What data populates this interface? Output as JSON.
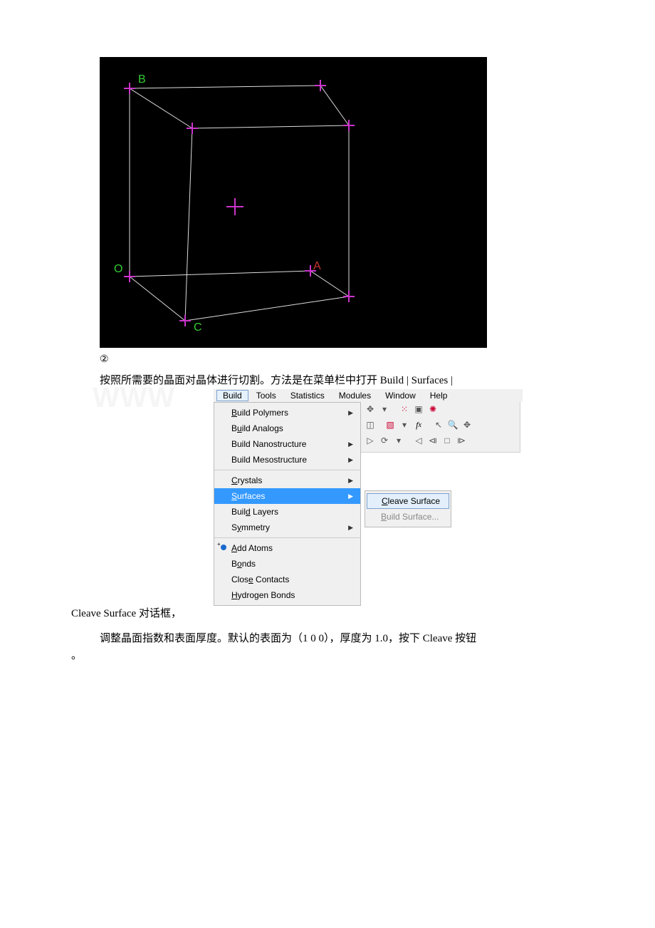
{
  "cube": {
    "labels": {
      "B": "B",
      "O": "O",
      "A": "A",
      "C": "C"
    }
  },
  "text": {
    "circled": "②",
    "p1": "按照所需要的晶面对晶体进行切割。方法是在菜单栏中打开 Build | Surfaces |",
    "cleave_suffix": "Cleave Surface 对话框，",
    "p2": "调整晶面指数和表面厚度。默认的表面为（1 0 0），厚度为 1.0，按下 Cleave 按钮",
    "p2_end": "。"
  },
  "menubar": {
    "items": [
      "Build",
      "Tools",
      "Statistics",
      "Modules",
      "Window",
      "Help"
    ],
    "selected": 0
  },
  "build_menu": {
    "g1": [
      {
        "label": "Build Polymers",
        "u": "",
        "arrow": true
      },
      {
        "label": "Build Analogs",
        "u": "",
        "arrow": false
      },
      {
        "label": "Build Nanostructure",
        "u": "",
        "arrow": true
      },
      {
        "label": "Build Mesostructure",
        "u": "",
        "arrow": true
      }
    ],
    "g2": [
      {
        "label": "Crystals",
        "u": "C",
        "arrow": true,
        "hi": false
      },
      {
        "label": "Surfaces",
        "u": "S",
        "arrow": true,
        "hi": true
      },
      {
        "label": "Build Layers",
        "u": "d",
        "arrow": false,
        "hi": false
      },
      {
        "label": "Symmetry",
        "u": "y",
        "arrow": true,
        "hi": false
      }
    ],
    "g3": [
      {
        "label": "Add Atoms",
        "u": "A",
        "icon": "atom"
      },
      {
        "label": "Bonds",
        "u": "o"
      },
      {
        "label": "Close Contacts",
        "u": "e"
      },
      {
        "label": "Hydrogen Bonds",
        "u": "H"
      }
    ]
  },
  "submenu": {
    "items": [
      {
        "label": "Cleave Surface",
        "u": "C",
        "hi": true,
        "dis": false
      },
      {
        "label": "Build Surface...",
        "u": "B",
        "hi": false,
        "dis": true
      }
    ]
  },
  "watermark": "WWW"
}
